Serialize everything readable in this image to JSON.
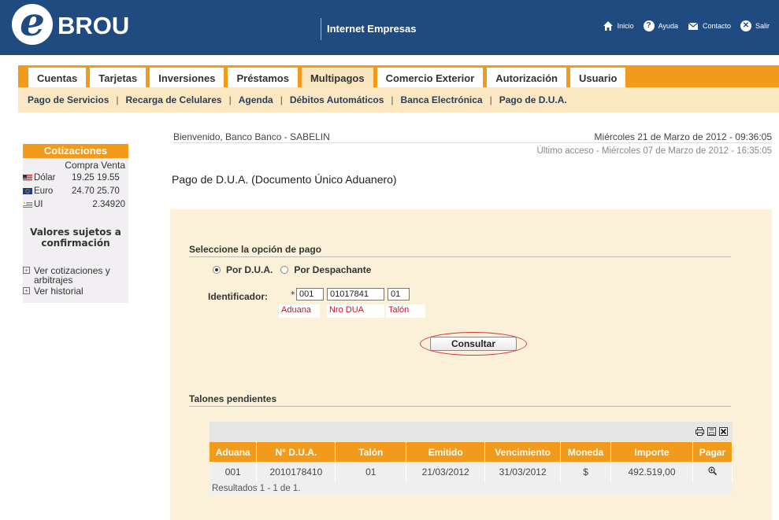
{
  "header": {
    "logo_letter": "e",
    "logo_text": "BROU",
    "app_title": "Internet Empresas",
    "links": [
      {
        "label": "Inicio",
        "icon": "home-icon"
      },
      {
        "label": "Ayuda",
        "icon": "help-icon"
      },
      {
        "label": "Contacto",
        "icon": "mail-icon"
      },
      {
        "label": "Salir",
        "icon": "close-icon"
      }
    ]
  },
  "tabs": [
    {
      "label": "Cuentas",
      "active": false
    },
    {
      "label": "Tarjetas",
      "active": false
    },
    {
      "label": "Inversiones",
      "active": false
    },
    {
      "label": "Préstamos",
      "active": false
    },
    {
      "label": "Multipagos",
      "active": true
    },
    {
      "label": "Comercio Exterior",
      "active": false
    },
    {
      "label": "Autorización",
      "active": false
    },
    {
      "label": "Usuario",
      "active": false
    }
  ],
  "subnav": [
    "Pago de Servicios",
    "Recarga de Celulares",
    "Agenda",
    "Débitos Automáticos",
    "Banca Electrónica",
    "Pago de D.U.A."
  ],
  "sidebar": {
    "title": "Cotizaciones",
    "head": "Compra Venta",
    "rates": [
      {
        "name": "Dólar",
        "values": "19.25 19.55",
        "flag": "us-flag-icon"
      },
      {
        "name": "Euro",
        "values": "24.70 25.70",
        "flag": "eu-flag-icon"
      },
      {
        "name": "UI",
        "values": "2.34920",
        "flag": "uy-flag-icon"
      }
    ],
    "note": "Valores sujetos a confirmación",
    "links": [
      "Ver cotizaciones y arbitrajes",
      "Ver historial"
    ]
  },
  "main": {
    "welcome": "Bienvenido, Banco Banco - SABELIN",
    "datetime": "Miércoles 21 de Marzo de 2012 - 09:36:05",
    "last_access": "Último acceso - Miércoles 07 de Marzo de 2012 - 16:35:05",
    "page_title": "Pago de D.U.A. (Documento Único Aduanero)",
    "section_payment": "Seleccione la opción de pago",
    "radio_dua": "Por D.U.A.",
    "radio_despachante": "Por Despachante",
    "identifier_label": "Identificador:",
    "required_mark": "*",
    "fields": {
      "aduana": "001",
      "nro_dua": "01017841",
      "talon": "01"
    },
    "hints": {
      "aduana": "Aduana",
      "nro_dua": "Nro DUA",
      "talon": "Talón"
    },
    "consult_button": "Consultar",
    "section_pending": "Talones pendientes"
  },
  "table": {
    "columns": [
      "Aduana",
      "N° D.U.A.",
      "Talón",
      "Emitido",
      "Vencimiento",
      "Moneda",
      "Importe",
      "Pagar"
    ],
    "rows": [
      [
        "001",
        "2010178410",
        "01",
        "21/03/2012",
        "31/03/2012",
        "$",
        "492.519,00"
      ]
    ],
    "results": "Resultados 1 - 1 de 1."
  },
  "colors": {
    "brand_blue": "#1f4b80",
    "accent_orange": "#f29a1b",
    "panel_bg": "#fbf1d9"
  }
}
